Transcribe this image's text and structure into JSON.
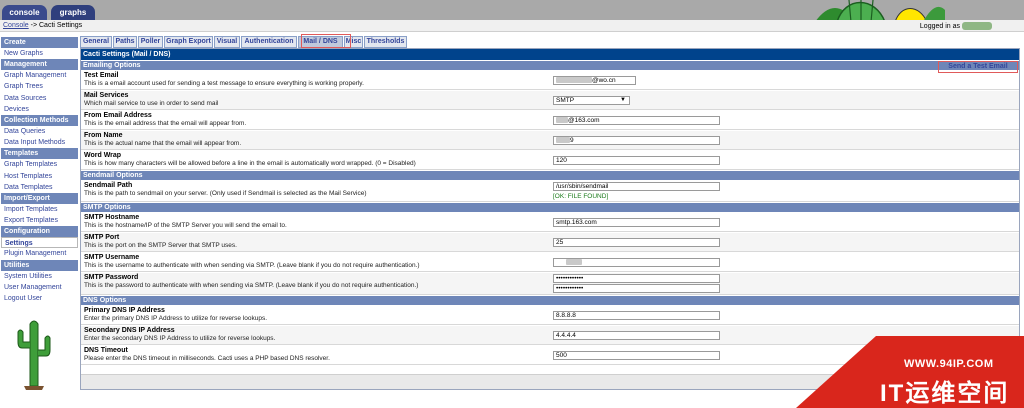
{
  "top_tabs": {
    "console": "console",
    "graphs": "graphs"
  },
  "breadcrumb": {
    "root": "Console",
    "sep": " -> ",
    "current": "Cacti Settings"
  },
  "logged_in": "Logged in as",
  "menu": [
    {
      "head": "Create",
      "items": [
        "New Graphs"
      ]
    },
    {
      "head": "Management",
      "items": [
        "Graph Management",
        "Graph Trees",
        "Data Sources",
        "Devices"
      ]
    },
    {
      "head": "Collection Methods",
      "items": [
        "Data Queries",
        "Data Input Methods"
      ]
    },
    {
      "head": "Templates",
      "items": [
        "Graph Templates",
        "Host Templates",
        "Data Templates"
      ]
    },
    {
      "head": "Import/Export",
      "items": [
        "Import Templates",
        "Export Templates"
      ]
    },
    {
      "head": "Configuration",
      "items": [
        "Settings",
        "Plugin Management"
      ]
    },
    {
      "head": "Utilities",
      "items": [
        "System Utilities",
        "User Management",
        "Logout User"
      ]
    }
  ],
  "menu_selected": "Settings",
  "settings_tabs": [
    "General",
    "Paths",
    "Poller",
    "Graph Export",
    "Visual",
    "Authentication",
    "Mail / DNS",
    "Misc",
    "Thresholds"
  ],
  "active_tab": "Mail / DNS",
  "panel_title": "Cacti Settings (Mail / DNS)",
  "send_test": "Send a Test Email",
  "sections": {
    "emailing": "Emailing Options",
    "sendmail": "Sendmail Options",
    "smtp": "SMTP Options",
    "dns": "DNS Options"
  },
  "fields": {
    "test_email": {
      "label": "Test Email",
      "desc": "This is a email account used for sending a test message to ensure everything is working properly.",
      "value": "@wo.cn"
    },
    "mail_services": {
      "label": "Mail Services",
      "desc": "Which mail service to use in order to send mail",
      "value": "SMTP"
    },
    "from_email": {
      "label": "From Email Address",
      "desc": "This is the email address that the email will appear from.",
      "value": "@163.com"
    },
    "from_name": {
      "label": "From Name",
      "desc": "This is the actual name that the email will appear from.",
      "value": "9"
    },
    "word_wrap": {
      "label": "Word Wrap",
      "desc": "This is how many characters will be allowed before a line in the email is automatically word wrapped. (0 = Disabled)",
      "value": "120"
    },
    "sendmail_path": {
      "label": "Sendmail Path",
      "desc": "This is the path to sendmail on your server. (Only used if Sendmail is selected as the Mail Service)",
      "value": "/usr/sbin/sendmail",
      "status": "[OK: FILE FOUND]"
    },
    "smtp_host": {
      "label": "SMTP Hostname",
      "desc": "This is the hostname/IP of the SMTP Server you will send the email to.",
      "value": "smtp.163.com"
    },
    "smtp_port": {
      "label": "SMTP Port",
      "desc": "This is the port on the SMTP Server that SMTP uses.",
      "value": "25"
    },
    "smtp_user": {
      "label": "SMTP Username",
      "desc": "This is the username to authenticate with when sending via SMTP. (Leave blank if you do not require authentication.)",
      "value": ""
    },
    "smtp_pass": {
      "label": "SMTP Password",
      "desc": "This is the password to authenticate with when sending via SMTP. (Leave blank if you do not require authentication.)",
      "value": "••••••••••••",
      "value2": "••••••••••••"
    },
    "dns_primary": {
      "label": "Primary DNS IP Address",
      "desc": "Enter the primary DNS IP Address to utilize for reverse lookups.",
      "value": "8.8.8.8"
    },
    "dns_secondary": {
      "label": "Secondary DNS IP Address",
      "desc": "Enter the secondary DNS IP Address to utilize for reverse lookups.",
      "value": "4.4.4.4"
    },
    "dns_timeout": {
      "label": "DNS Timeout",
      "desc": "Please enter the DNS timeout in milliseconds. Cacti uses a PHP based DNS resolver.",
      "value": "500"
    }
  },
  "watermark": {
    "url": "WWW.94IP.COM",
    "text": "IT运维空间"
  },
  "colors": {
    "header": "#00438c",
    "section": "#6e86b8",
    "link": "#33459a",
    "ok": "#1a7a1a",
    "watermark": "#d9261c"
  }
}
